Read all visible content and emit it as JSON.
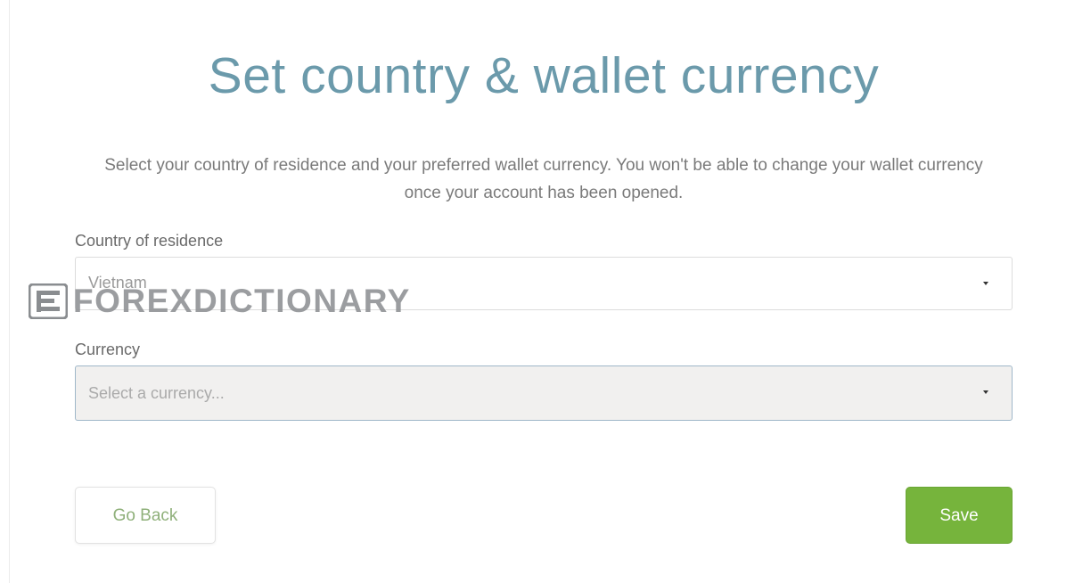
{
  "title": "Set country & wallet currency",
  "subtitle": "Select your country of residence and your preferred wallet currency. You won't be able to change your wallet currency once your account has been opened.",
  "country": {
    "label": "Country of residence",
    "value": "Vietnam"
  },
  "currency": {
    "label": "Currency",
    "placeholder": "Select a currency..."
  },
  "buttons": {
    "back_label": "Go Back",
    "save_label": "Save"
  },
  "watermark": {
    "text": "FOREXDICTIONARY",
    "icon": "forexdictionary-logo-icon"
  },
  "colors": {
    "title": "#6b9aab",
    "save_button": "#76b43c",
    "back_button_text": "#8fb07a",
    "currency_focus_border": "#9fb7c9"
  },
  "icons": {
    "dropdown": "caret-down-icon"
  }
}
